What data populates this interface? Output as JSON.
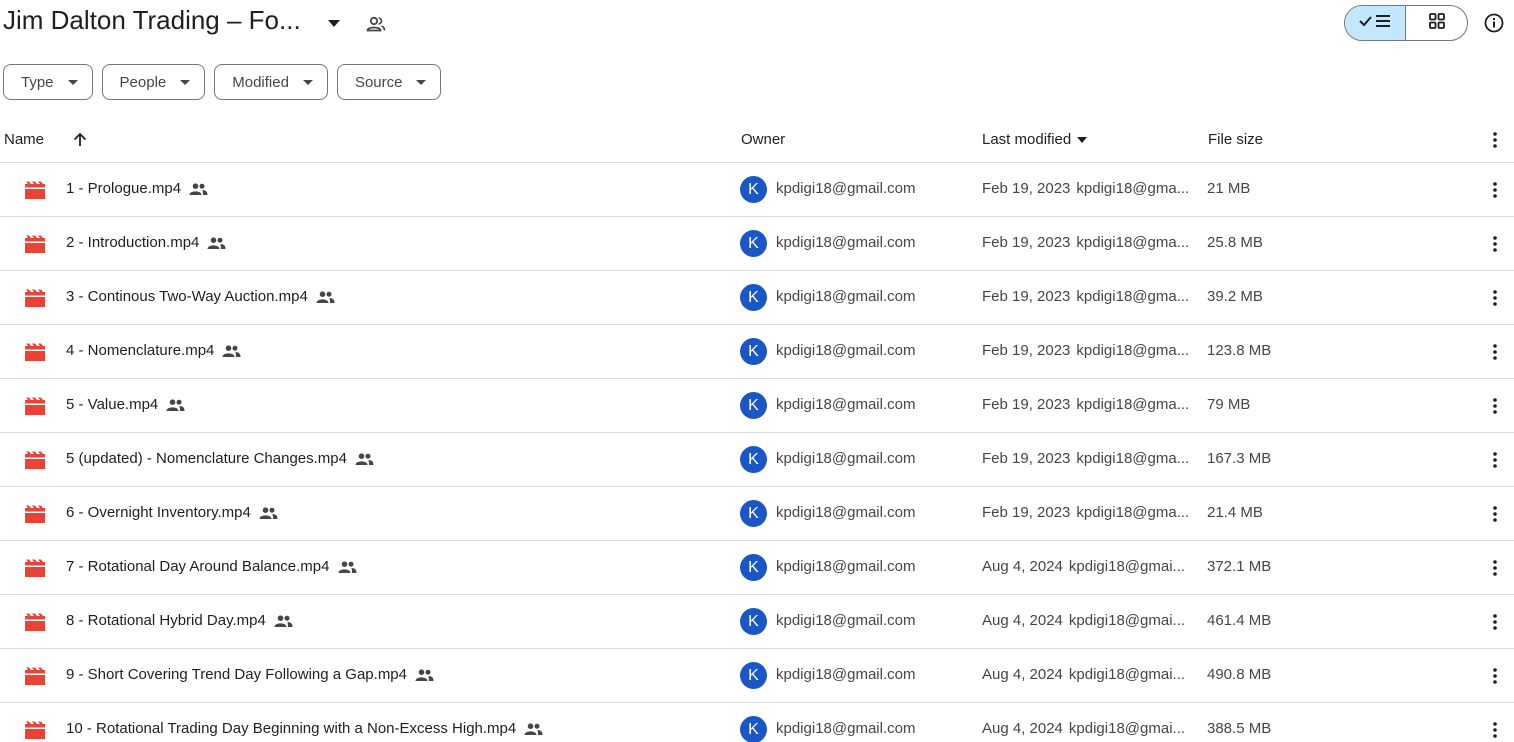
{
  "header": {
    "title": "Jim Dalton Trading – Fo...",
    "title_caret_icon": "arrow-drop-down-icon",
    "shared_icon": "people-outline-icon",
    "view_toggle": {
      "list_icon": "check-list-icon",
      "grid_icon": "grid-icon",
      "active": "list"
    },
    "info_icon": "info-icon"
  },
  "filters": [
    {
      "label": "Type"
    },
    {
      "label": "People"
    },
    {
      "label": "Modified"
    },
    {
      "label": "Source"
    }
  ],
  "table": {
    "headers": {
      "name": "Name",
      "owner": "Owner",
      "last_modified": "Last modified",
      "file_size": "File size"
    },
    "sort_icon": "arrow-up-icon",
    "colors": {
      "file_icon": "#ea4335",
      "avatar_bg": "#1a56c4",
      "view_active_bg": "#c2e7ff"
    },
    "rows": [
      {
        "name": "1 - Prologue.mp4",
        "avatar": "K",
        "owner": "kpdigi18@gmail.com",
        "modified_date": "Feb 19, 2023",
        "modified_by": "kpdigi18@gma...",
        "size": "21 MB"
      },
      {
        "name": "2 - Introduction.mp4",
        "avatar": "K",
        "owner": "kpdigi18@gmail.com",
        "modified_date": "Feb 19, 2023",
        "modified_by": "kpdigi18@gma...",
        "size": "25.8 MB"
      },
      {
        "name": "3 - Continous Two-Way Auction.mp4",
        "avatar": "K",
        "owner": "kpdigi18@gmail.com",
        "modified_date": "Feb 19, 2023",
        "modified_by": "kpdigi18@gma...",
        "size": "39.2 MB"
      },
      {
        "name": "4 - Nomenclature.mp4",
        "avatar": "K",
        "owner": "kpdigi18@gmail.com",
        "modified_date": "Feb 19, 2023",
        "modified_by": "kpdigi18@gma...",
        "size": "123.8 MB"
      },
      {
        "name": "5 - Value.mp4",
        "avatar": "K",
        "owner": "kpdigi18@gmail.com",
        "modified_date": "Feb 19, 2023",
        "modified_by": "kpdigi18@gma...",
        "size": "79 MB"
      },
      {
        "name": "5 (updated) - Nomenclature Changes.mp4",
        "avatar": "K",
        "owner": "kpdigi18@gmail.com",
        "modified_date": "Feb 19, 2023",
        "modified_by": "kpdigi18@gma...",
        "size": "167.3 MB"
      },
      {
        "name": "6 - Overnight Inventory.mp4",
        "avatar": "K",
        "owner": "kpdigi18@gmail.com",
        "modified_date": "Feb 19, 2023",
        "modified_by": "kpdigi18@gma...",
        "size": "21.4 MB"
      },
      {
        "name": "7 - Rotational Day Around Balance.mp4",
        "avatar": "K",
        "owner": "kpdigi18@gmail.com",
        "modified_date": "Aug 4, 2024",
        "modified_by": "kpdigi18@gmai...",
        "size": "372.1 MB"
      },
      {
        "name": "8 - Rotational Hybrid Day.mp4",
        "avatar": "K",
        "owner": "kpdigi18@gmail.com",
        "modified_date": "Aug 4, 2024",
        "modified_by": "kpdigi18@gmai...",
        "size": "461.4 MB"
      },
      {
        "name": "9 - Short Covering Trend Day Following a Gap.mp4",
        "avatar": "K",
        "owner": "kpdigi18@gmail.com",
        "modified_date": "Aug 4, 2024",
        "modified_by": "kpdigi18@gmai...",
        "size": "490.8 MB"
      },
      {
        "name": "10 - Rotational Trading Day Beginning with a Non-Excess High.mp4",
        "avatar": "K",
        "owner": "kpdigi18@gmail.com",
        "modified_date": "Aug 4, 2024",
        "modified_by": "kpdigi18@gmai...",
        "size": "388.5 MB"
      }
    ]
  }
}
